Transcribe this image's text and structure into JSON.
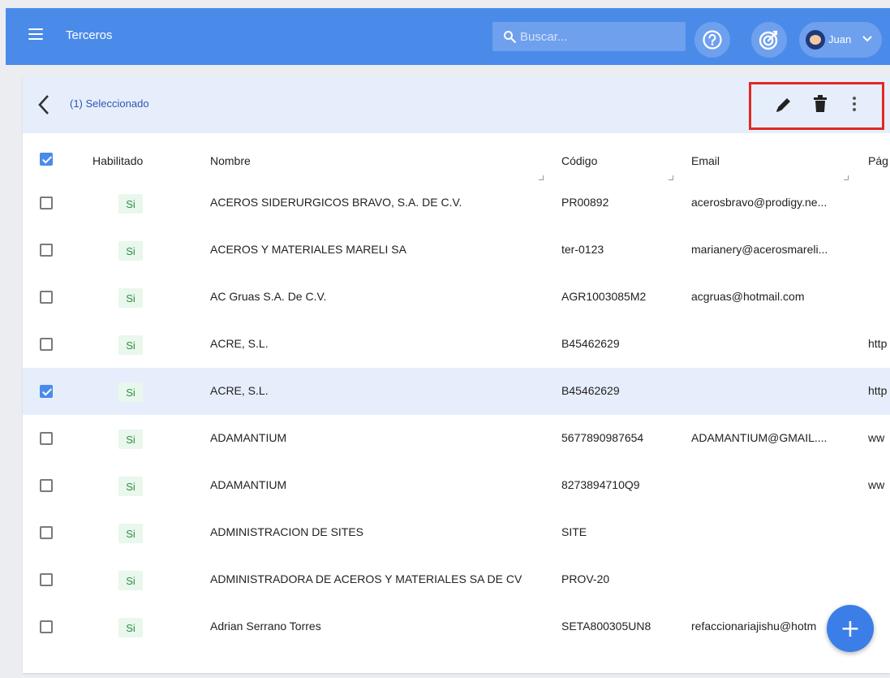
{
  "app": {
    "title": "Terceros"
  },
  "search": {
    "placeholder": "Buscar..."
  },
  "user": {
    "name": "Juan"
  },
  "selection": {
    "text": "(1) Seleccionado"
  },
  "table": {
    "columns": [
      "Habilitado",
      "Nombre",
      "Código",
      "Email",
      "Pág"
    ],
    "rows": [
      {
        "enabled": "Si",
        "name": "ACEROS SIDERURGICOS BRAVO, S.A. DE C.V.",
        "code": "PR00892",
        "email": "acerosbravo@prodigy.ne...",
        "page": "",
        "checked": false
      },
      {
        "enabled": "Si",
        "name": "ACEROS Y MATERIALES MARELI SA",
        "code": "ter-0123",
        "email": "marianery@acerosmareli...",
        "page": "",
        "checked": false
      },
      {
        "enabled": "Si",
        "name": "AC Gruas S.A. De C.V.",
        "code": "AGR1003085M2",
        "email": "acgruas@hotmail.com",
        "page": "",
        "checked": false
      },
      {
        "enabled": "Si",
        "name": "ACRE, S.L.",
        "code": "B45462629",
        "email": "",
        "page": "http",
        "checked": false
      },
      {
        "enabled": "Si",
        "name": "ACRE, S.L.",
        "code": "B45462629",
        "email": "",
        "page": "http",
        "checked": true
      },
      {
        "enabled": "Si",
        "name": "ADAMANTIUM",
        "code": "5677890987654",
        "email": "ADAMANTIUM@GMAIL....",
        "page": "ww",
        "checked": false
      },
      {
        "enabled": "Si",
        "name": "ADAMANTIUM",
        "code": "8273894710Q9",
        "email": "",
        "page": "ww",
        "checked": false
      },
      {
        "enabled": "Si",
        "name": "ADMINISTRACION DE SITES",
        "code": "SITE",
        "email": "",
        "page": "",
        "checked": false
      },
      {
        "enabled": "Si",
        "name": "ADMINISTRADORA DE ACEROS Y MATERIALES SA DE CV",
        "code": "PROV-20",
        "email": "",
        "page": "",
        "checked": false
      },
      {
        "enabled": "Si",
        "name": "Adrian Serrano Torres",
        "code": "SETA800305UN8",
        "email": "refaccionariajishu@hotm",
        "page": "",
        "checked": false
      }
    ]
  },
  "fab": {
    "label": "+"
  },
  "colors": {
    "topbar": "#4a8bea",
    "selected_row": "#e7eefb",
    "highlight": "#e02a24",
    "badge_bg": "#e9f7ec",
    "badge_text": "#2e8f47"
  }
}
